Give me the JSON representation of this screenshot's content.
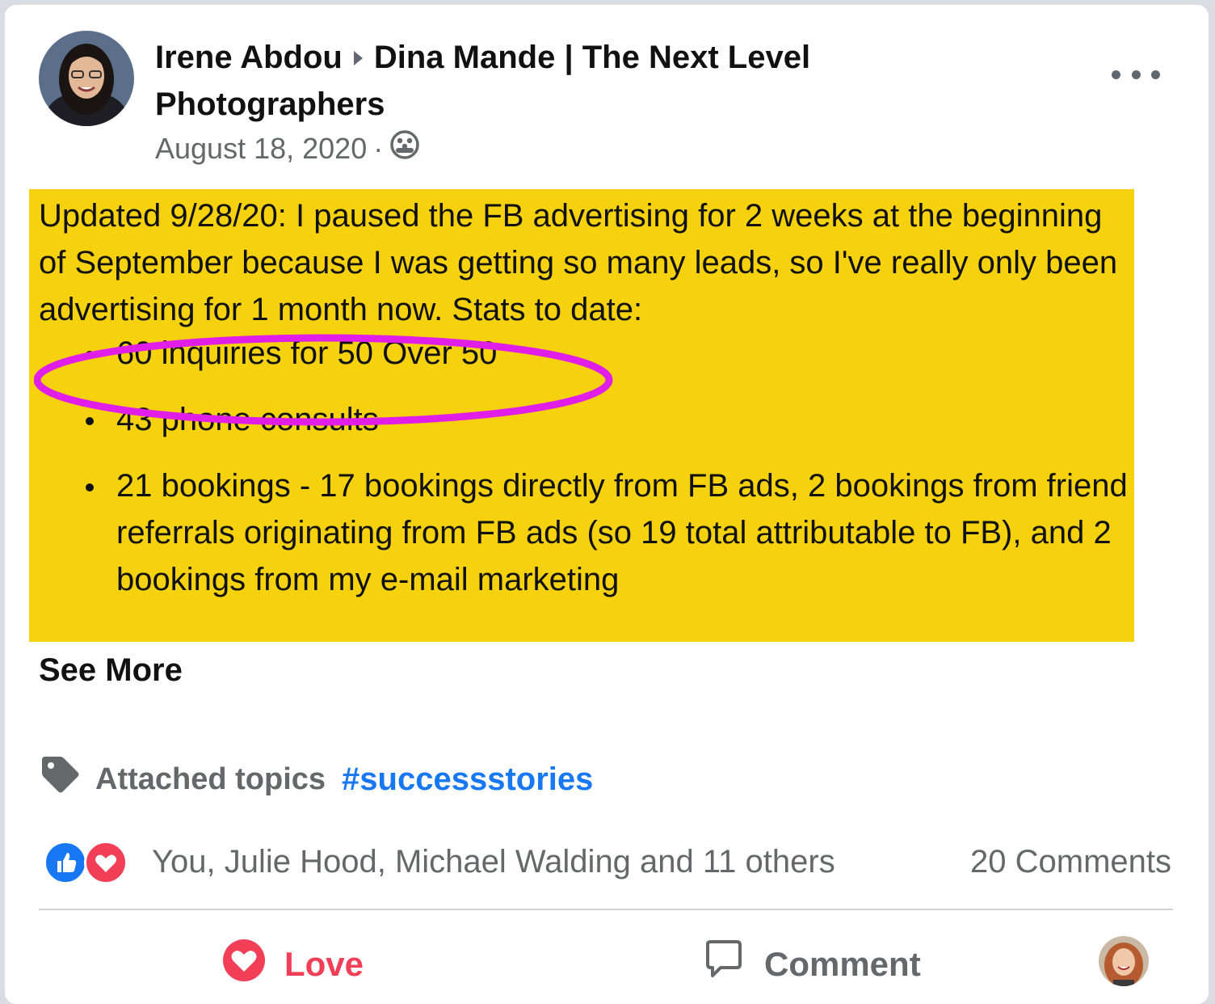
{
  "post": {
    "author": "Irene Abdou",
    "group": "Dina Mande | The Next Level Photographers",
    "date": "August 18, 2020",
    "separator": "·",
    "privacy_icon": "group-members-icon",
    "more_icon": "more-options-icon",
    "body_intro": "Updated 9/28/20: I paused the FB advertising for 2 weeks at the beginning of September because I was getting so many leads, so I've really only been advertising for 1 month now. Stats to date:",
    "bullets": [
      "60 inquiries for 50 Over 50",
      "43 phone consults",
      "21 bookings - 17 bookings directly from FB ads, 2 bookings from friend referrals originating from FB ads (so 19 total attributable to FB), and 2 bookings from my e-mail marketing"
    ],
    "highlight_color": "#f5d20d",
    "circle_color": "#e01ee8",
    "see_more": "See More"
  },
  "topics": {
    "label": "Attached topics",
    "hashtag": "#successstories",
    "icon": "tag-icon"
  },
  "reactions": {
    "summary": "You, Julie Hood, Michael Walding and 11 others",
    "comments": "20 Comments",
    "icons": [
      "like-icon",
      "love-icon"
    ]
  },
  "actions": {
    "love_label": "Love",
    "comment_label": "Comment",
    "love_color": "#f33e58"
  },
  "colors": {
    "link": "#1877f2",
    "secondary_text": "#65676b"
  }
}
